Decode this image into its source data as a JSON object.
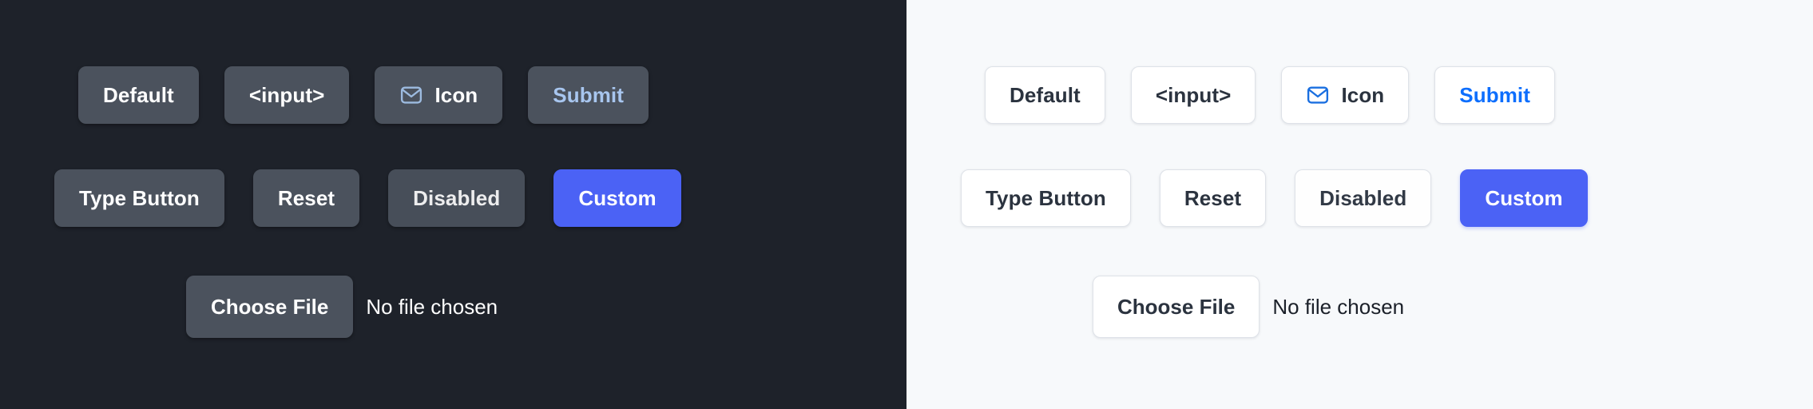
{
  "panels": [
    {
      "theme": "dark",
      "background": "#1e222a",
      "rows": [
        [
          {
            "label": "Default",
            "name": "default-button",
            "variant": "plain",
            "icon": null
          },
          {
            "label": "<input>",
            "name": "input-button",
            "variant": "plain",
            "icon": null
          },
          {
            "label": "Icon",
            "name": "icon-button",
            "variant": "plain",
            "icon": "envelope-icon"
          },
          {
            "label": "Submit",
            "name": "submit-button",
            "variant": "submit",
            "icon": null
          }
        ],
        [
          {
            "label": "Type Button",
            "name": "type-button",
            "variant": "plain",
            "icon": null
          },
          {
            "label": "Reset",
            "name": "reset-button",
            "variant": "plain",
            "icon": null
          },
          {
            "label": "Disabled",
            "name": "disabled-button",
            "variant": "disabled",
            "icon": null
          },
          {
            "label": "Custom",
            "name": "custom-button",
            "variant": "custom",
            "icon": null
          }
        ]
      ],
      "file_input": {
        "button_label": "Choose File",
        "status_text": "No file chosen"
      },
      "colors": {
        "button_bg": "#4b525d",
        "button_text": "#ffffff",
        "submit_text": "#a8c6ef",
        "custom_bg": "#4b62f5",
        "custom_text": "#ffffff",
        "icon_stroke": "#9dbbe0"
      }
    },
    {
      "theme": "light",
      "background": "#f7f9fb",
      "rows": [
        [
          {
            "label": "Default",
            "name": "default-button",
            "variant": "plain",
            "icon": null
          },
          {
            "label": "<input>",
            "name": "input-button",
            "variant": "plain",
            "icon": null
          },
          {
            "label": "Icon",
            "name": "icon-button",
            "variant": "plain",
            "icon": "envelope-icon"
          },
          {
            "label": "Submit",
            "name": "submit-button",
            "variant": "submit",
            "icon": null
          }
        ],
        [
          {
            "label": "Type Button",
            "name": "type-button",
            "variant": "plain",
            "icon": null
          },
          {
            "label": "Reset",
            "name": "reset-button",
            "variant": "plain",
            "icon": null
          },
          {
            "label": "Disabled",
            "name": "disabled-button",
            "variant": "disabled",
            "icon": null
          },
          {
            "label": "Custom",
            "name": "custom-button",
            "variant": "custom",
            "icon": null
          }
        ]
      ],
      "file_input": {
        "button_label": "Choose File",
        "status_text": "No file chosen"
      },
      "colors": {
        "button_bg": "#ffffff",
        "button_border": "#dee2e8",
        "button_text": "#2b333f",
        "submit_text": "#0d6efd",
        "custom_bg": "#4b62f5",
        "custom_text": "#ffffff",
        "icon_stroke": "#1a6fe0"
      }
    }
  ]
}
